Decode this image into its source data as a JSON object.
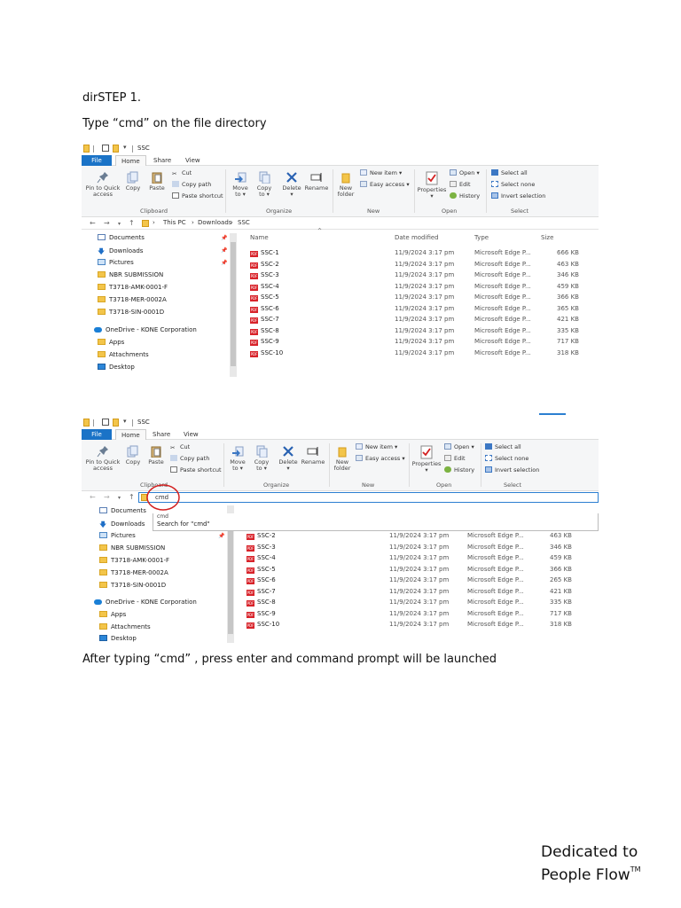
{
  "intro": "dirSTEP 1.",
  "instruction": "Type “cmd” on the file directory",
  "after_text": "After typing “cmd” , press enter and command prompt will be launched",
  "brand": {
    "line1": "Dedicated to",
    "line2": "People Flow",
    "tm": "TM"
  },
  "explorer": {
    "title": "SSC",
    "tabs": [
      "File",
      "Home",
      "Share",
      "View"
    ],
    "ribbon": {
      "pin": [
        "Pin to Quick",
        "access"
      ],
      "copy": "Copy",
      "paste": "Paste",
      "cut": "Cut",
      "copy_path": "Copy path",
      "paste_shortcut": "Paste shortcut",
      "move_to": [
        "Move",
        "to"
      ],
      "copy_to": [
        "Copy",
        "to"
      ],
      "delete": "Delete",
      "rename": "Rename",
      "new_folder": [
        "New",
        "folder"
      ],
      "new_item": "New item",
      "easy_access": "Easy access",
      "properties": "Properties",
      "open": "Open",
      "edit": "Edit",
      "history": "History",
      "select_all": "Select all",
      "select_none": "Select none",
      "invert_selection": "Invert selection",
      "groups": [
        "Clipboard",
        "Organize",
        "New",
        "Open",
        "Select"
      ]
    },
    "breadcrumb": [
      "This PC",
      "Downloads",
      "SSC"
    ],
    "nav_items": [
      "Documents",
      "Downloads",
      "Pictures",
      "NBR SUBMISSION",
      "T3718-AMK-0001-F",
      "T3718-MER-0002A",
      "T3718-SIN-0001D",
      "OneDrive - KONE Corporation",
      "Apps",
      "Attachments",
      "Desktop"
    ],
    "columns": [
      "Name",
      "Date modified",
      "Type",
      "Size"
    ],
    "files": [
      {
        "name": "SSC-1",
        "date": "11/9/2024 3:17 pm",
        "type": "Microsoft Edge P...",
        "size": "666 KB"
      },
      {
        "name": "SSC-2",
        "date": "11/9/2024 3:17 pm",
        "type": "Microsoft Edge P...",
        "size": "463 KB"
      },
      {
        "name": "SSC-3",
        "date": "11/9/2024 3:17 pm",
        "type": "Microsoft Edge P...",
        "size": "346 KB"
      },
      {
        "name": "SSC-4",
        "date": "11/9/2024 3:17 pm",
        "type": "Microsoft Edge P...",
        "size": "459 KB"
      },
      {
        "name": "SSC-5",
        "date": "11/9/2024 3:17 pm",
        "type": "Microsoft Edge P...",
        "size": "366 KB"
      },
      {
        "name": "SSC-6",
        "date": "11/9/2024 3:17 pm",
        "type": "Microsoft Edge P...",
        "size": "365 KB"
      },
      {
        "name": "SSC-7",
        "date": "11/9/2024 3:17 pm",
        "type": "Microsoft Edge P...",
        "size": "421 KB"
      },
      {
        "name": "SSC-8",
        "date": "11/9/2024 3:17 pm",
        "type": "Microsoft Edge P...",
        "size": "335 KB"
      },
      {
        "name": "SSC-9",
        "date": "11/9/2024 3:17 pm",
        "type": "Microsoft Edge P...",
        "size": "717 KB"
      },
      {
        "name": "SSC-10",
        "date": "11/9/2024 3:17 pm",
        "type": "Microsoft Edge P...",
        "size": "318 KB"
      }
    ],
    "address_input": "cmd",
    "dropdown": [
      "cmd",
      "Search for \"cmd\""
    ],
    "files2": [
      {
        "name": "SSC-2",
        "date": "11/9/2024 3:17 pm",
        "type": "Microsoft Edge P...",
        "size": "463 KB"
      },
      {
        "name": "SSC-3",
        "date": "11/9/2024 3:17 pm",
        "type": "Microsoft Edge P...",
        "size": "346 KB"
      },
      {
        "name": "SSC-4",
        "date": "11/9/2024 3:17 pm",
        "type": "Microsoft Edge P...",
        "size": "459 KB"
      },
      {
        "name": "SSC-5",
        "date": "11/9/2024 3:17 pm",
        "type": "Microsoft Edge P...",
        "size": "366 KB"
      },
      {
        "name": "SSC-6",
        "date": "11/9/2024 3:17 pm",
        "type": "Microsoft Edge P...",
        "size": "265 KB"
      },
      {
        "name": "SSC-7",
        "date": "11/9/2024 3:17 pm",
        "type": "Microsoft Edge P...",
        "size": "421 KB"
      },
      {
        "name": "SSC-8",
        "date": "11/9/2024 3:17 pm",
        "type": "Microsoft Edge P...",
        "size": "335 KB"
      },
      {
        "name": "SSC-9",
        "date": "11/9/2024 3:17 pm",
        "type": "Microsoft Edge P...",
        "size": "717 KB"
      },
      {
        "name": "SSC-10",
        "date": "11/9/2024 3:17 pm",
        "type": "Microsoft Edge P...",
        "size": "318 KB"
      }
    ],
    "pdf_badge": "PDF"
  },
  "colors": {
    "accent": "#1a73c7",
    "highlight_circle": "#d32020",
    "pdf_icon": "#d8232a"
  }
}
